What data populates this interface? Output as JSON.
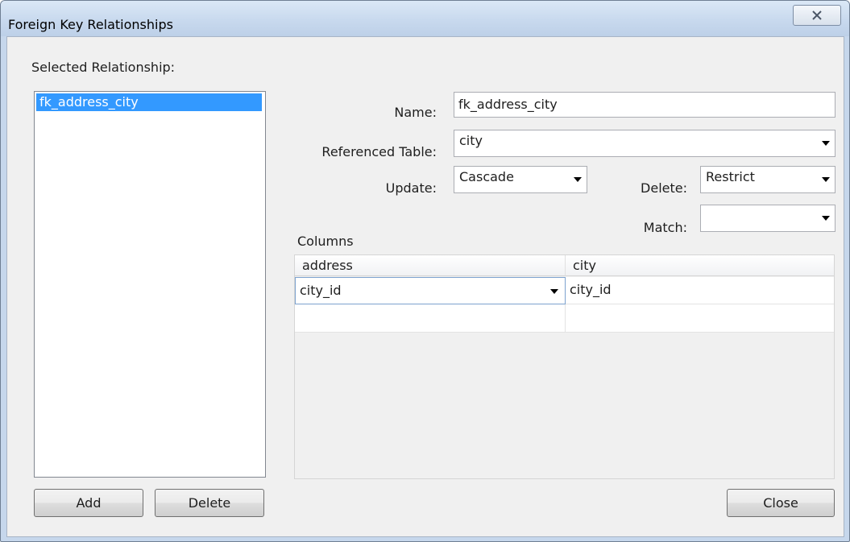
{
  "window": {
    "title": "Foreign Key Relationships",
    "close_glyph": "X"
  },
  "left": {
    "selected_label": "Selected Relationship:",
    "items": [
      "fk_address_city"
    ],
    "add_label": "Add",
    "delete_label": "Delete"
  },
  "form": {
    "name_label": "Name:",
    "name_value": "fk_address_city",
    "referenced_table_label": "Referenced Table:",
    "referenced_table_value": "city",
    "update_label": "Update:",
    "update_value": "Cascade",
    "delete_label": "Delete:",
    "delete_value": "Restrict",
    "match_label": "Match:",
    "match_value": ""
  },
  "columns": {
    "label": "Columns",
    "headers": [
      "address",
      "city"
    ],
    "rows": [
      [
        "city_id",
        "city_id"
      ],
      [
        "",
        ""
      ]
    ]
  },
  "footer": {
    "close_label": "Close"
  },
  "colors": {
    "selection": "#3399ff",
    "titlebar": "#c8d9ee",
    "client": "#f0f0f0"
  }
}
